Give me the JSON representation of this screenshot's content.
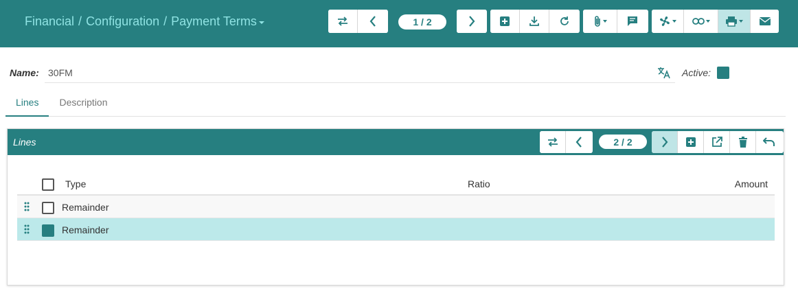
{
  "breadcrumb": {
    "parts": [
      "Financial",
      "Configuration",
      "Payment Terms"
    ],
    "separator": "/"
  },
  "toolbar": {
    "pager": "1 / 2",
    "icons": [
      "swap-icon",
      "chevron-left-icon",
      "chevron-right-icon",
      "add-icon",
      "download-icon",
      "refresh-icon",
      "attachment-icon",
      "comment-icon",
      "action-icon",
      "link-icon",
      "print-icon",
      "email-icon"
    ]
  },
  "form": {
    "name_label": "Name:",
    "name_value": "30FM",
    "active_label": "Active:",
    "active_checked": true
  },
  "tabs": [
    {
      "label": "Lines",
      "selected": true
    },
    {
      "label": "Description",
      "selected": false
    }
  ],
  "lines_panel": {
    "title": "Lines",
    "pager": "2 / 2",
    "columns": {
      "type": "Type",
      "ratio": "Ratio",
      "amount": "Amount"
    },
    "rows": [
      {
        "type": "Remainder",
        "ratio": "",
        "amount": "",
        "checked": false
      },
      {
        "type": "Remainder",
        "ratio": "",
        "amount": "",
        "checked": true
      }
    ]
  },
  "colors": {
    "brand": "#267f80",
    "breadcrumb_text": "#8fe3e3",
    "selected_row": "#bce9ea"
  }
}
